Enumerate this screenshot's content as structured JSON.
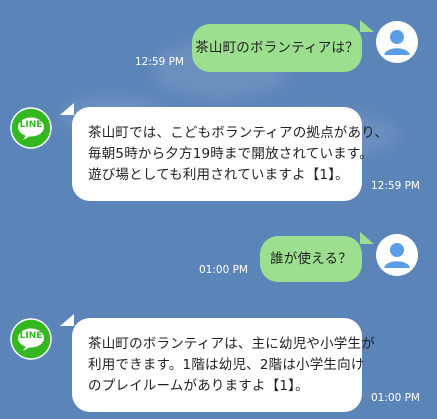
{
  "messages": [
    {
      "from": "user",
      "text": "茶山町のボランティアは？",
      "time": "12:59 PM"
    },
    {
      "from": "bot",
      "lines": [
        "茶山町では、こどもボランティアの拠点があり、",
        "毎朝5時から夕方19時まで開放されています。",
        "遊び場としても利用されていますよ【1】。"
      ],
      "time": "12:59 PM"
    },
    {
      "from": "user",
      "text": "誰が使える？",
      "time": "01:00 PM"
    },
    {
      "from": "bot",
      "lines": [
        "茶山町のボランティアは、主に幼児や小学生が",
        "利用できます。1階は幼児、2階は小学生向け",
        "のプレイルームがありますよ【1】。"
      ],
      "time": "01:00 PM"
    }
  ],
  "bot_logo_label": "LINE",
  "colors": {
    "background": "#5b84b8",
    "user_bubble": "#9ce08f",
    "bot_bubble": "#ffffff",
    "logo_green": "#34b821",
    "avatar_blue": "#5a9ee8"
  }
}
